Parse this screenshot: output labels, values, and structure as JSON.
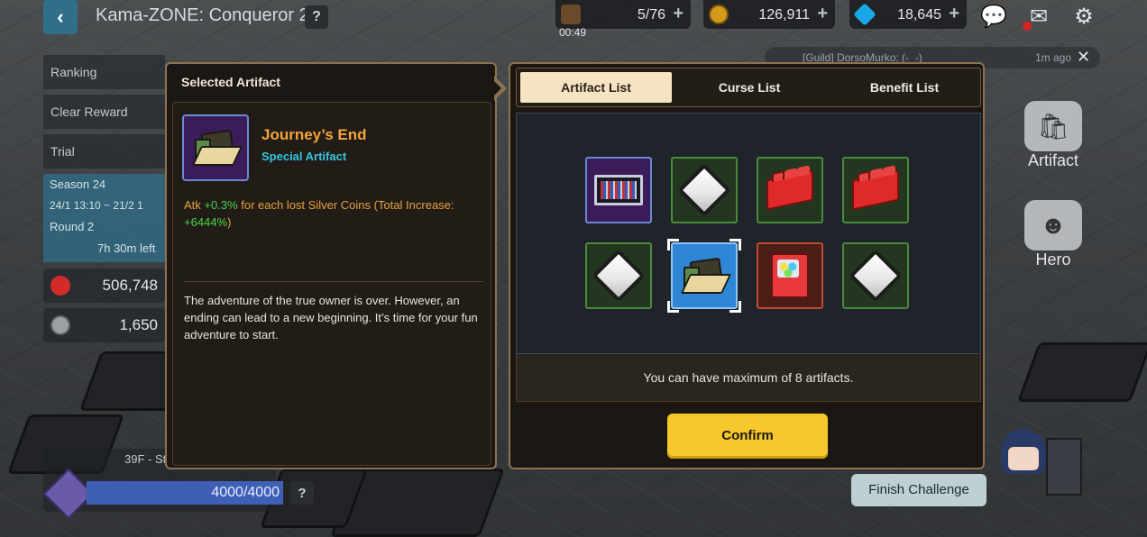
{
  "topbar": {
    "title": "Kama-ZONE: Conqueror 2",
    "help": "?",
    "stamina": "5/76",
    "timer": "00:49",
    "gold": "126,911",
    "gems": "18,645"
  },
  "chat": {
    "message": "[Guild] DorsoMurko: (-_-)",
    "ago": "1m ago"
  },
  "sidebar": {
    "items": [
      "Ranking",
      "Clear Reward",
      "Trial"
    ],
    "season": "Season 24",
    "dates": "24/1 13:10 ~ 21/2 1",
    "round": "Round 2",
    "time_left": "7h 30m left",
    "stat1": "506,748",
    "stat2": "1,650"
  },
  "floor": {
    "label": "39F - St",
    "progress_text": "4000/4000",
    "progress": 1.0,
    "help": "?"
  },
  "right_menu": {
    "artifact": "Artifact",
    "hero": "Hero",
    "finish": "Finish Challenge"
  },
  "selected": {
    "header": "Selected Artifact",
    "name": "Journey’s End",
    "type": "Special Artifact",
    "desc_prefix": "Atk ",
    "desc_bonus": "+0.3%",
    "desc_mid": " for each lost Silver Coins (Total Increase: ",
    "desc_total": "+6444%",
    "desc_suffix": ")",
    "lore": "The adventure of the true owner is over. However, an ending can lead to a new beginning. It’s time for your fun adventure to start."
  },
  "tabs": {
    "artifact": "Artifact List",
    "curse": "Curse List",
    "benefit": "Benefit List"
  },
  "artifacts": [
    {
      "icon": "monitor-icon",
      "frame": "purple"
    },
    {
      "icon": "white-diamond-icon",
      "frame": "green"
    },
    {
      "icon": "red-brick-icon",
      "frame": "green"
    },
    {
      "icon": "red-brick-icon",
      "frame": "green"
    },
    {
      "icon": "white-diamond-icon",
      "frame": "green"
    },
    {
      "icon": "wallet-icon",
      "frame": "selected"
    },
    {
      "icon": "gacha-machine-icon",
      "frame": "red"
    },
    {
      "icon": "white-diamond-icon",
      "frame": "green"
    }
  ],
  "note": "You can have maximum of 8 artifacts.",
  "confirm": "Confirm",
  "colors": {
    "accent_gold": "#f7c82c",
    "name_orange": "#f2a53a",
    "type_cyan": "#33c7e0",
    "bonus_green": "#46d64a"
  }
}
